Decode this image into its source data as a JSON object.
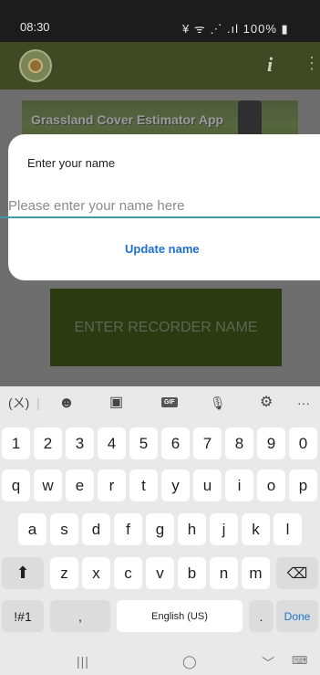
{
  "status_bar": {
    "time": "08:30",
    "indicators": "¥ ᯤ ⋰ .ıl 100% ▮"
  },
  "app_bar": {
    "logo_icon": "app-logo-icon",
    "info_glyph": "i",
    "more_glyph": "⋮"
  },
  "banner": {
    "title": "Grassland Cover Estimator App"
  },
  "recorder_button": {
    "label": "ENTER RECORDER NAME"
  },
  "dialog": {
    "title": "Enter your name",
    "input_placeholder": "Please enter your name here",
    "input_value": "",
    "update_label": "Update name",
    "accent_color": "#3e9aa6",
    "button_color": "#1d6fd1"
  },
  "keyboard": {
    "toolbar": {
      "translate": "(ㄨ)",
      "emoji": "☻",
      "sticker": "▣",
      "gif": "GIF",
      "mic": "🎙",
      "settings": "⚙",
      "more": "···"
    },
    "row1": [
      "1",
      "2",
      "3",
      "4",
      "5",
      "6",
      "7",
      "8",
      "9",
      "0"
    ],
    "row2": [
      "q",
      "w",
      "e",
      "r",
      "t",
      "y",
      "u",
      "i",
      "o",
      "p"
    ],
    "row3": [
      "a",
      "s",
      "d",
      "f",
      "g",
      "h",
      "j",
      "k",
      "l"
    ],
    "row4": [
      "z",
      "x",
      "c",
      "v",
      "b",
      "n",
      "m"
    ],
    "shift": "⬆",
    "backspace": "⌫",
    "symbols": "!#1",
    "comma": ",",
    "space": "English (US)",
    "period": ".",
    "done": "Done"
  },
  "nav_bar": {
    "recents": "|||",
    "home": "◯",
    "back": "﹀",
    "keyboard": "⌨"
  }
}
